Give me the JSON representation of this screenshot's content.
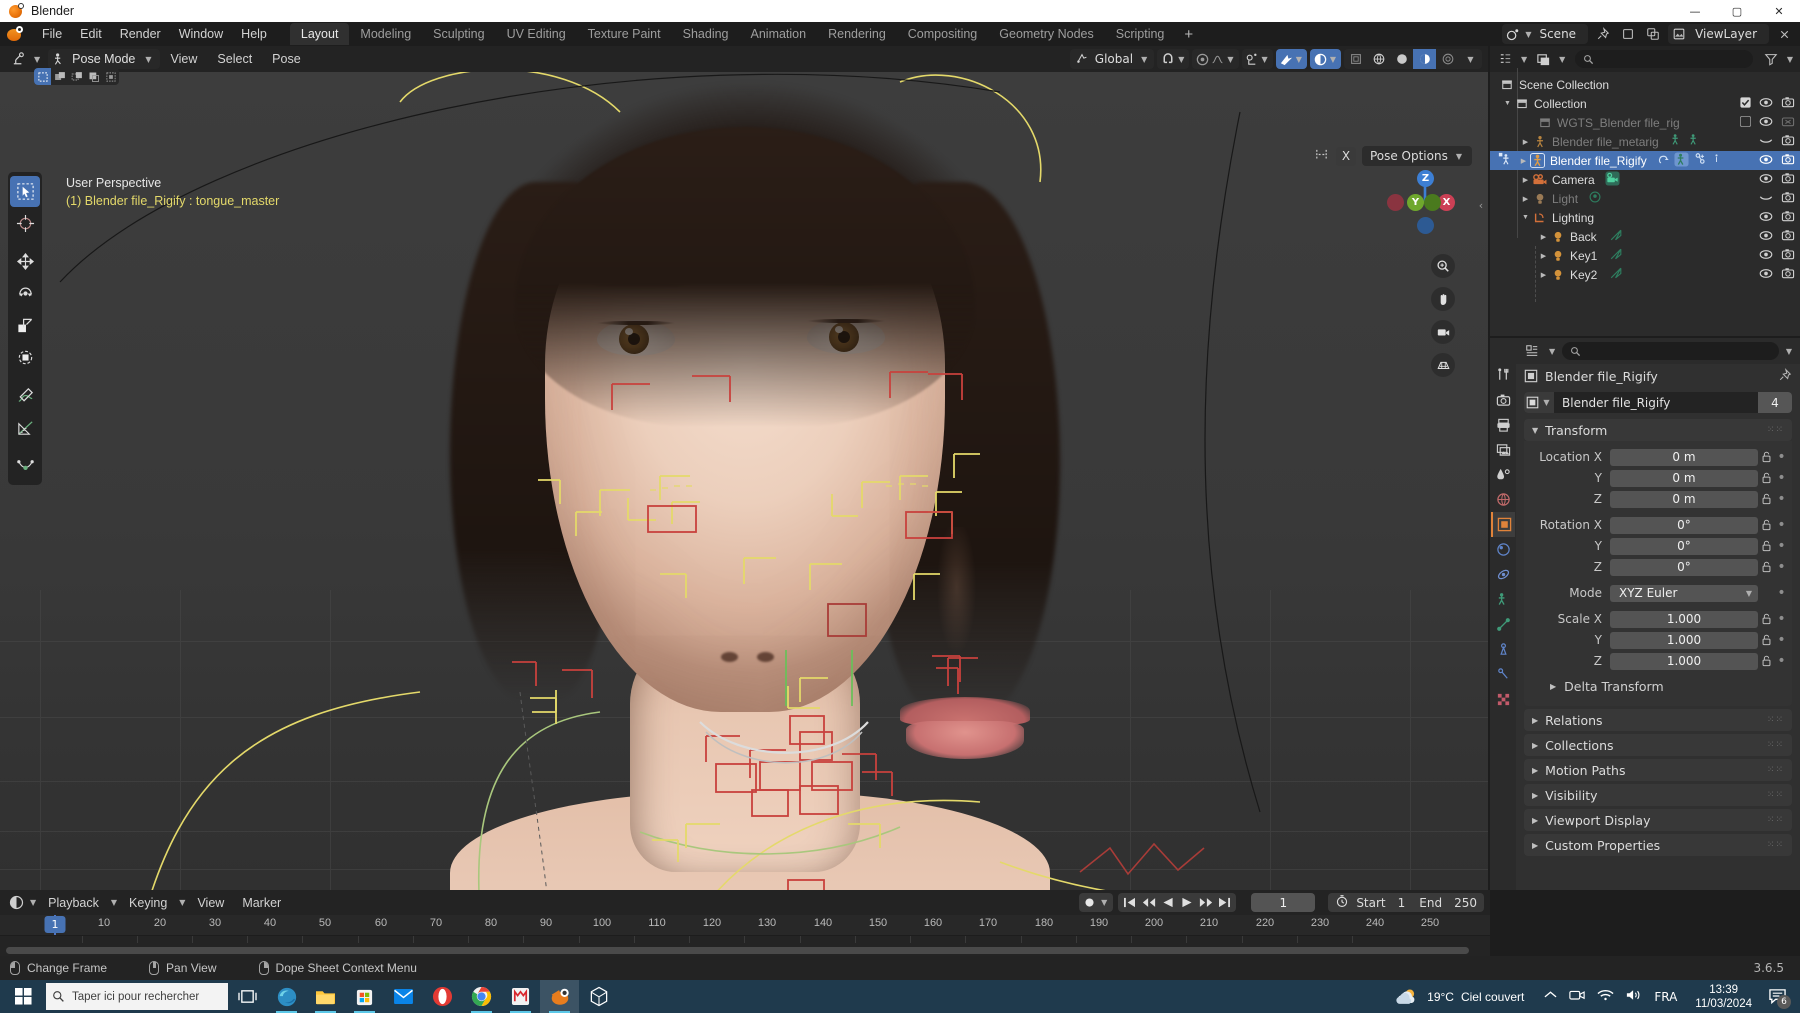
{
  "window": {
    "title": "Blender",
    "minimize": "—",
    "maximize": "▢",
    "close": "✕"
  },
  "topbar": {
    "menus": [
      "File",
      "Edit",
      "Render",
      "Window",
      "Help"
    ],
    "workspaces": [
      {
        "label": "Layout",
        "active": true
      },
      {
        "label": "Modeling",
        "active": false
      },
      {
        "label": "Sculpting",
        "active": false
      },
      {
        "label": "UV Editing",
        "active": false
      },
      {
        "label": "Texture Paint",
        "active": false
      },
      {
        "label": "Shading",
        "active": false
      },
      {
        "label": "Animation",
        "active": false
      },
      {
        "label": "Rendering",
        "active": false
      },
      {
        "label": "Compositing",
        "active": false
      },
      {
        "label": "Geometry Nodes",
        "active": false
      },
      {
        "label": "Scripting",
        "active": false
      }
    ],
    "add_workspace": "+",
    "scene_name": "Scene",
    "viewlayer_name": "ViewLayer"
  },
  "viewport_header": {
    "mode": "Pose Mode",
    "menus": [
      "View",
      "Select",
      "Pose"
    ],
    "transform_orientation": "Global",
    "select_modes": [
      "set-select",
      "extend-select",
      "subtract-select",
      "invert-select",
      "intersect-select"
    ]
  },
  "viewport": {
    "perspective_label": "User Perspective",
    "active_object_label": "(1) Blender file_Rigify : tongue_master",
    "pose_options_label": "Pose Options",
    "x_button": "X",
    "gizmo_axes": [
      "X",
      "Y",
      "Z"
    ],
    "tools": [
      "tweak-select-tool",
      "cursor-tool",
      "move-tool",
      "rotate-tool",
      "scale-tool",
      "transform-tool",
      "annotate-tool",
      "measure-tool",
      "breakdowner-tool"
    ]
  },
  "outliner": {
    "title": "Scene Collection",
    "search_placeholder": "",
    "rows": [
      {
        "name": "Scene Collection",
        "indent": 0,
        "icon": "collection-icon",
        "disclosure": "",
        "dim": false,
        "selected": false,
        "checkbox": false,
        "eye": false,
        "camera": false
      },
      {
        "name": "Collection",
        "indent": 1,
        "icon": "collection-icon",
        "disclosure": "▼",
        "dim": false,
        "selected": false,
        "checkbox": "checked",
        "eye": true,
        "camera": true
      },
      {
        "name": "WGTS_Blender file_rig",
        "indent": 2,
        "icon": "collection-icon",
        "disclosure": "",
        "dim": true,
        "selected": false,
        "checkbox": "unchecked",
        "eye": true,
        "camera": "disabled"
      },
      {
        "name": "Blender file_metarig",
        "indent": 2,
        "icon": "armature-icon",
        "disclosure": "▶",
        "dim": true,
        "selected": false,
        "checkbox": false,
        "eye": "closed",
        "camera": true
      },
      {
        "name": "Blender file_Rigify",
        "indent": 2,
        "icon": "armature-icon",
        "disclosure": "▶",
        "dim": false,
        "selected": true,
        "checkbox": false,
        "eye": true,
        "camera": true
      },
      {
        "name": "Camera",
        "indent": 2,
        "icon": "camera-icon",
        "disclosure": "▶",
        "dim": false,
        "selected": false,
        "checkbox": false,
        "eye": true,
        "camera": true
      },
      {
        "name": "Light",
        "indent": 2,
        "icon": "light-icon",
        "disclosure": "▶",
        "dim": true,
        "selected": false,
        "checkbox": false,
        "eye": "closed",
        "camera": true
      },
      {
        "name": "Lighting",
        "indent": 2,
        "icon": "empty-icon",
        "disclosure": "▼",
        "dim": false,
        "selected": false,
        "checkbox": false,
        "eye": true,
        "camera": true
      },
      {
        "name": "Back",
        "indent": 3,
        "icon": "light-icon",
        "disclosure": "▶",
        "dim": false,
        "selected": false,
        "checkbox": false,
        "eye": true,
        "camera": true
      },
      {
        "name": "Key1",
        "indent": 3,
        "icon": "light-icon",
        "disclosure": "▶",
        "dim": false,
        "selected": false,
        "checkbox": false,
        "eye": true,
        "camera": true
      },
      {
        "name": "Key2",
        "indent": 3,
        "icon": "light-icon",
        "disclosure": "▶",
        "dim": false,
        "selected": false,
        "checkbox": false,
        "eye": true,
        "camera": true
      }
    ]
  },
  "properties": {
    "search_placeholder": "",
    "breadcrumb": "Blender file_Rigify",
    "id_name": "Blender file_Rigify",
    "id_users": "4",
    "tabs": [
      "tool-icon",
      "render-icon",
      "output-icon",
      "view-layer-icon",
      "scene-icon",
      "world-icon",
      "object-icon",
      "modifiers-icon",
      "physics-icon",
      "object-constraints-icon",
      "object-data-icon",
      "bone-icon",
      "bone-constraints-icon",
      "material-icon"
    ],
    "transform": {
      "title": "Transform",
      "fields": [
        {
          "label": "Location X",
          "value": "0 m",
          "lock": true
        },
        {
          "label": "Y",
          "value": "0 m",
          "lock": true
        },
        {
          "label": "Z",
          "value": "0 m",
          "lock": true
        },
        {
          "label": "Rotation X",
          "value": "0°",
          "lock": true
        },
        {
          "label": "Y",
          "value": "0°",
          "lock": true
        },
        {
          "label": "Z",
          "value": "0°",
          "lock": true
        },
        {
          "label": "Mode",
          "value": "XYZ Euler",
          "lock": false,
          "dropdown": true
        },
        {
          "label": "Scale X",
          "value": "1.000",
          "lock": true
        },
        {
          "label": "Y",
          "value": "1.000",
          "lock": true
        },
        {
          "label": "Z",
          "value": "1.000",
          "lock": true
        }
      ],
      "sub_panel": "Delta Transform"
    },
    "closed_panels": [
      "Relations",
      "Collections",
      "Motion Paths",
      "Visibility",
      "Viewport Display",
      "Custom Properties"
    ]
  },
  "timeline": {
    "menus": [
      "Playback",
      "Keying",
      "View",
      "Marker"
    ],
    "current_frame": "1",
    "start_label": "Start",
    "start_value": "1",
    "end_label": "End",
    "end_value": "250",
    "ticks": [
      "1",
      "10",
      "20",
      "30",
      "40",
      "50",
      "60",
      "70",
      "80",
      "90",
      "100",
      "110",
      "120",
      "130",
      "140",
      "150",
      "160",
      "170",
      "180",
      "190",
      "200",
      "210",
      "220",
      "230",
      "240",
      "250"
    ],
    "playhead_label": "1"
  },
  "statusbar": {
    "items": [
      {
        "mouse": "lmb",
        "label": "Change Frame"
      },
      {
        "mouse": "mmb",
        "label": "Pan View"
      },
      {
        "mouse": "rmb",
        "label": "Dope Sheet Context Menu"
      }
    ],
    "version": "3.6.5"
  },
  "taskbar": {
    "search_placeholder": "Taper ici pour rechercher",
    "apps": [
      "task-view-icon",
      "edge-icon",
      "file-explorer-icon",
      "microsoft-store-icon",
      "mail-icon",
      "opera-icon",
      "chrome-icon",
      "mega-icon",
      "blender-icon",
      "3d-viewer-icon"
    ],
    "weather_temp": "19°C",
    "weather_desc": "Ciel couvert",
    "language": "FRA",
    "time": "13:39",
    "date": "11/03/2024",
    "notification_count": "6"
  },
  "colors": {
    "accent_blue": "#4772b3",
    "blender_orange": "#e0833a",
    "bone_yellow": "#e4d96a",
    "bone_red": "#d34848",
    "bone_green": "#6cbf5a",
    "taskbar_bg": "#1f3a4d"
  }
}
